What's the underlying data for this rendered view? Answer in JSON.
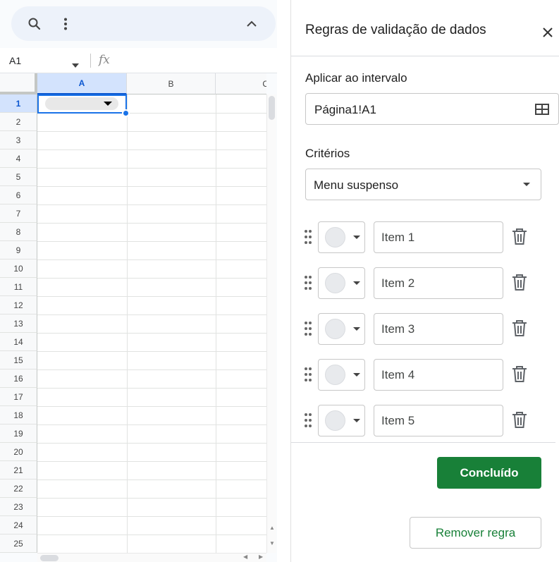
{
  "formula_bar": {
    "cell_ref": "A1",
    "fx_label": "fx"
  },
  "grid": {
    "columns": [
      {
        "label": "A",
        "selected": true
      },
      {
        "label": "B",
        "selected": false
      },
      {
        "label": "C",
        "selected": false
      }
    ],
    "rows": [
      "1",
      "2",
      "3",
      "4",
      "5",
      "6",
      "7",
      "8",
      "9",
      "10",
      "11",
      "12",
      "13",
      "14",
      "15",
      "16",
      "17",
      "18",
      "19",
      "20",
      "21",
      "22",
      "23",
      "24",
      "25"
    ],
    "selected_row": "1"
  },
  "panel": {
    "title": "Regras de validação de dados",
    "range_label": "Aplicar ao intervalo",
    "range_value": "Página1!A1",
    "criteria_label": "Critérios",
    "criteria_value": "Menu suspenso",
    "items": [
      {
        "value": "Item 1"
      },
      {
        "value": "Item 2"
      },
      {
        "value": "Item 3"
      },
      {
        "value": "Item 4"
      },
      {
        "value": "Item 5"
      }
    ],
    "done_label": "Concluído",
    "remove_label": "Remover regra"
  },
  "colors": {
    "accent_green": "#188038",
    "selection_blue": "#1a73e8",
    "chip_gray": "#e8eaed"
  },
  "icons": [
    "search-icon",
    "more-vert-icon",
    "chevron-up-icon",
    "close-icon",
    "grid-select-icon",
    "drag-handle-icon",
    "trash-icon"
  ]
}
